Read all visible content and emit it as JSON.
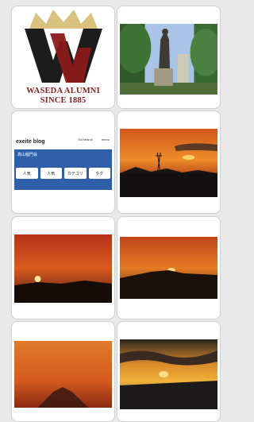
{
  "gallery": {
    "tiles": [
      {
        "kind": "logo",
        "logo_line1": "WASEDA ALUMNI",
        "logo_line2": "SINCE 1885"
      },
      {
        "kind": "photo",
        "subject": "statue-among-trees"
      },
      {
        "kind": "blog",
        "blog_logo": "exeite blog",
        "header_right_1": "Sci search",
        "header_right_2": "menu",
        "blog_title": "高山稲門会",
        "buttons": [
          "人気",
          "人気",
          "カテゴリ",
          "タグ"
        ]
      },
      {
        "kind": "photo",
        "subject": "sunset-over-towers"
      },
      {
        "kind": "photo",
        "subject": "sunset-red-sky"
      },
      {
        "kind": "photo",
        "subject": "sunset-over-mountain"
      },
      {
        "kind": "photo",
        "subject": "mountain-silhouette-orange"
      },
      {
        "kind": "photo",
        "subject": "sunset-clouds"
      }
    ]
  },
  "colors": {
    "background": "#e9e9e9",
    "tile": "#ffffff",
    "logo_red": "#8b1a1a",
    "logo_gold": "#d9c27e",
    "blog_blue": "#2f5fa8"
  }
}
